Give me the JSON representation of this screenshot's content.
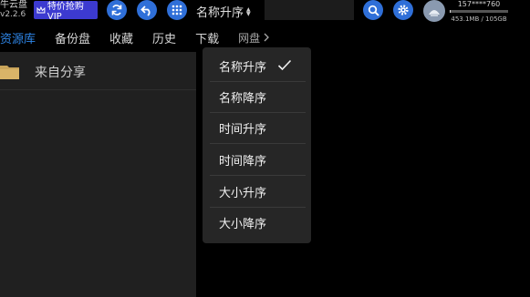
{
  "app": {
    "title": "牛云盘",
    "version": "v2.2.6"
  },
  "vip_badge": {
    "label": "特价抢购VIP"
  },
  "toolbar": {
    "sort_label": "名称升序",
    "icons": [
      "refresh-icon",
      "back-icon",
      "grid-icon",
      "search-icon",
      "gear-icon"
    ]
  },
  "account": {
    "name": "157****760",
    "storage_text": "453.1MB / 105GB",
    "storage_fraction": 0.0042
  },
  "tabs": [
    {
      "label": "资源库",
      "active": true
    },
    {
      "label": "备份盘",
      "active": false
    },
    {
      "label": "收藏",
      "active": false
    },
    {
      "label": "历史",
      "active": false
    },
    {
      "label": "下载",
      "active": false
    },
    {
      "label": "网盘",
      "active": false
    }
  ],
  "file_list": {
    "items": [
      {
        "label": "来自分享",
        "icon": "folder-icon"
      }
    ]
  },
  "sort_menu": {
    "items": [
      {
        "label": "名称升序",
        "selected": true
      },
      {
        "label": "名称降序",
        "selected": false
      },
      {
        "label": "时间升序",
        "selected": false
      },
      {
        "label": "时间降序",
        "selected": false
      },
      {
        "label": "大小升序",
        "selected": false
      },
      {
        "label": "大小降序",
        "selected": false
      }
    ]
  },
  "colors": {
    "accent": "#2e86e8",
    "icon_button": "#2f6fd8",
    "vip_badge": "#3c3ad0",
    "panel": "#202020",
    "menu": "#262626"
  }
}
